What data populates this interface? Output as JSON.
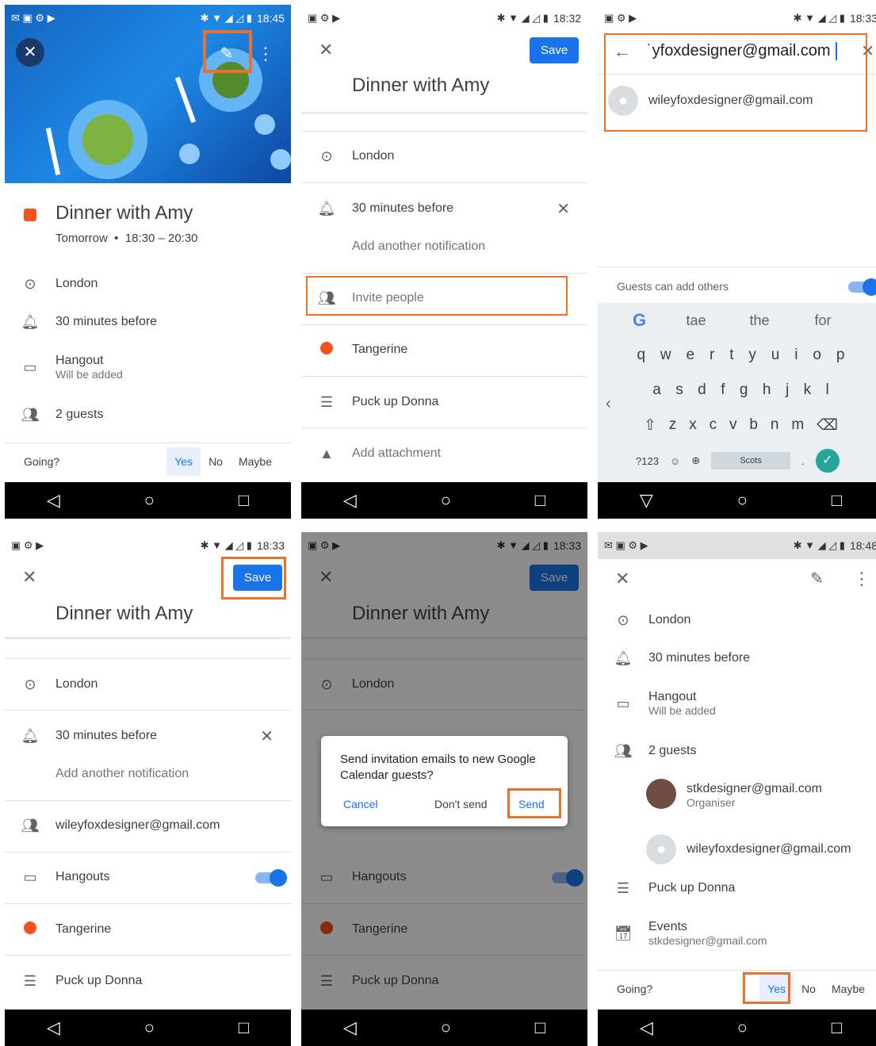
{
  "status": {
    "p1_time": "18:45",
    "p2_time": "18:32",
    "p3_time": "18:33",
    "p4_time": "18:33",
    "p5_time": "18:33",
    "p6_time": "18:48"
  },
  "event": {
    "title": "Dinner with Amy",
    "when": "Tomorrow  •  18:30 – 20:30",
    "location": "London",
    "notification": "30 minutes before",
    "add_notification": "Add another notification",
    "hangout": "Hangout",
    "hangout_sub": "Will be added",
    "hangouts": "Hangouts",
    "guests": "2 guests",
    "invite": "Invite people",
    "color": "Tangerine",
    "description": "Puck up Donna",
    "attachment": "Add attachment",
    "guest_email": "wileyfoxdesigner@gmail.com",
    "organiser_email": "stkdesigner@gmail.com",
    "organiser_label": "Organiser",
    "calendar": "Events",
    "calendar_account": "stkdesigner@gmail.com"
  },
  "rsvp": {
    "label": "Going?",
    "yes": "Yes",
    "no": "No",
    "maybe": "Maybe"
  },
  "buttons": {
    "save": "Save"
  },
  "search": {
    "query": "˙yfoxdesigner@gmail.com",
    "suggestion": "wileyfoxdesigner@gmail.com",
    "guests_can_add": "Guests can add others"
  },
  "keyboard": {
    "suggestions": [
      "tae",
      "the",
      "for"
    ],
    "row1": [
      "q",
      "w",
      "e",
      "r",
      "t",
      "y",
      "u",
      "i",
      "o",
      "p"
    ],
    "row2": [
      "a",
      "s",
      "d",
      "f",
      "g",
      "h",
      "j",
      "k",
      "l"
    ],
    "row3": [
      "z",
      "x",
      "c",
      "v",
      "b",
      "n",
      "m"
    ],
    "numkey": "?123",
    "space": "Scots",
    "period": "."
  },
  "dialog": {
    "message": "Send invitation emails to new Google Calendar guests?",
    "cancel": "Cancel",
    "dont_send": "Don't send",
    "send": "Send"
  },
  "colors": {
    "accent": "#1a73e8",
    "highlight": "#e8712d",
    "tangerine": "#f4511e",
    "hero": "#1e88e5"
  }
}
